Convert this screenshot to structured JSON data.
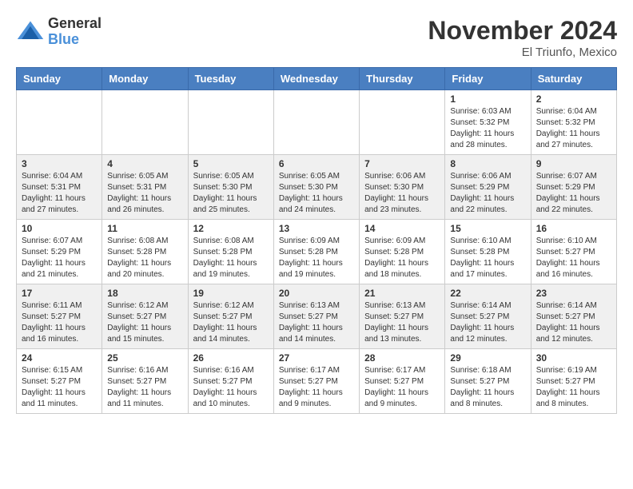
{
  "logo": {
    "general": "General",
    "blue": "Blue"
  },
  "header": {
    "month": "November 2024",
    "location": "El Triunfo, Mexico"
  },
  "days_of_week": [
    "Sunday",
    "Monday",
    "Tuesday",
    "Wednesday",
    "Thursday",
    "Friday",
    "Saturday"
  ],
  "weeks": [
    [
      {
        "day": "",
        "info": ""
      },
      {
        "day": "",
        "info": ""
      },
      {
        "day": "",
        "info": ""
      },
      {
        "day": "",
        "info": ""
      },
      {
        "day": "",
        "info": ""
      },
      {
        "day": "1",
        "info": "Sunrise: 6:03 AM\nSunset: 5:32 PM\nDaylight: 11 hours and 28 minutes."
      },
      {
        "day": "2",
        "info": "Sunrise: 6:04 AM\nSunset: 5:32 PM\nDaylight: 11 hours and 27 minutes."
      }
    ],
    [
      {
        "day": "3",
        "info": "Sunrise: 6:04 AM\nSunset: 5:31 PM\nDaylight: 11 hours and 27 minutes."
      },
      {
        "day": "4",
        "info": "Sunrise: 6:05 AM\nSunset: 5:31 PM\nDaylight: 11 hours and 26 minutes."
      },
      {
        "day": "5",
        "info": "Sunrise: 6:05 AM\nSunset: 5:30 PM\nDaylight: 11 hours and 25 minutes."
      },
      {
        "day": "6",
        "info": "Sunrise: 6:05 AM\nSunset: 5:30 PM\nDaylight: 11 hours and 24 minutes."
      },
      {
        "day": "7",
        "info": "Sunrise: 6:06 AM\nSunset: 5:30 PM\nDaylight: 11 hours and 23 minutes."
      },
      {
        "day": "8",
        "info": "Sunrise: 6:06 AM\nSunset: 5:29 PM\nDaylight: 11 hours and 22 minutes."
      },
      {
        "day": "9",
        "info": "Sunrise: 6:07 AM\nSunset: 5:29 PM\nDaylight: 11 hours and 22 minutes."
      }
    ],
    [
      {
        "day": "10",
        "info": "Sunrise: 6:07 AM\nSunset: 5:29 PM\nDaylight: 11 hours and 21 minutes."
      },
      {
        "day": "11",
        "info": "Sunrise: 6:08 AM\nSunset: 5:28 PM\nDaylight: 11 hours and 20 minutes."
      },
      {
        "day": "12",
        "info": "Sunrise: 6:08 AM\nSunset: 5:28 PM\nDaylight: 11 hours and 19 minutes."
      },
      {
        "day": "13",
        "info": "Sunrise: 6:09 AM\nSunset: 5:28 PM\nDaylight: 11 hours and 19 minutes."
      },
      {
        "day": "14",
        "info": "Sunrise: 6:09 AM\nSunset: 5:28 PM\nDaylight: 11 hours and 18 minutes."
      },
      {
        "day": "15",
        "info": "Sunrise: 6:10 AM\nSunset: 5:28 PM\nDaylight: 11 hours and 17 minutes."
      },
      {
        "day": "16",
        "info": "Sunrise: 6:10 AM\nSunset: 5:27 PM\nDaylight: 11 hours and 16 minutes."
      }
    ],
    [
      {
        "day": "17",
        "info": "Sunrise: 6:11 AM\nSunset: 5:27 PM\nDaylight: 11 hours and 16 minutes."
      },
      {
        "day": "18",
        "info": "Sunrise: 6:12 AM\nSunset: 5:27 PM\nDaylight: 11 hours and 15 minutes."
      },
      {
        "day": "19",
        "info": "Sunrise: 6:12 AM\nSunset: 5:27 PM\nDaylight: 11 hours and 14 minutes."
      },
      {
        "day": "20",
        "info": "Sunrise: 6:13 AM\nSunset: 5:27 PM\nDaylight: 11 hours and 14 minutes."
      },
      {
        "day": "21",
        "info": "Sunrise: 6:13 AM\nSunset: 5:27 PM\nDaylight: 11 hours and 13 minutes."
      },
      {
        "day": "22",
        "info": "Sunrise: 6:14 AM\nSunset: 5:27 PM\nDaylight: 11 hours and 12 minutes."
      },
      {
        "day": "23",
        "info": "Sunrise: 6:14 AM\nSunset: 5:27 PM\nDaylight: 11 hours and 12 minutes."
      }
    ],
    [
      {
        "day": "24",
        "info": "Sunrise: 6:15 AM\nSunset: 5:27 PM\nDaylight: 11 hours and 11 minutes."
      },
      {
        "day": "25",
        "info": "Sunrise: 6:16 AM\nSunset: 5:27 PM\nDaylight: 11 hours and 11 minutes."
      },
      {
        "day": "26",
        "info": "Sunrise: 6:16 AM\nSunset: 5:27 PM\nDaylight: 11 hours and 10 minutes."
      },
      {
        "day": "27",
        "info": "Sunrise: 6:17 AM\nSunset: 5:27 PM\nDaylight: 11 hours and 9 minutes."
      },
      {
        "day": "28",
        "info": "Sunrise: 6:17 AM\nSunset: 5:27 PM\nDaylight: 11 hours and 9 minutes."
      },
      {
        "day": "29",
        "info": "Sunrise: 6:18 AM\nSunset: 5:27 PM\nDaylight: 11 hours and 8 minutes."
      },
      {
        "day": "30",
        "info": "Sunrise: 6:19 AM\nSunset: 5:27 PM\nDaylight: 11 hours and 8 minutes."
      }
    ]
  ]
}
